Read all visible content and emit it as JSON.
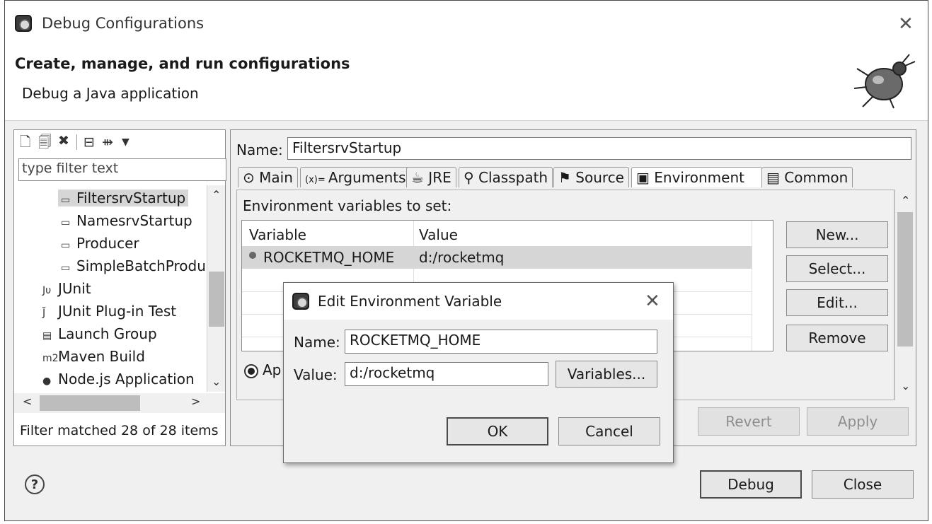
{
  "window": {
    "title": "Debug Configurations",
    "header_title": "Create, manage, and run configurations",
    "header_subtitle": "Debug a Java application",
    "icons": {
      "app": "eclipse-debug-icon",
      "bug": "bug-icon",
      "close": "close-icon"
    }
  },
  "left_panel": {
    "toolbar": [
      "new-config-icon",
      "duplicate-icon",
      "delete-icon",
      "collapse-all-icon",
      "filter-icon",
      "dropdown-arrow-icon"
    ],
    "filter_placeholder": "type filter text",
    "tree": [
      {
        "label": "FiltersrvStartup",
        "icon": "java-app-icon",
        "level": 2,
        "selected": true
      },
      {
        "label": "NamesrvStartup",
        "icon": "java-app-icon",
        "level": 2
      },
      {
        "label": "Producer",
        "icon": "java-app-icon",
        "level": 2
      },
      {
        "label": "SimpleBatchProdu",
        "icon": "java-app-icon",
        "level": 2
      },
      {
        "label": "JUnit",
        "icon": "junit-icon",
        "level": 1
      },
      {
        "label": "JUnit Plug-in Test",
        "icon": "junit-plugin-icon",
        "level": 1
      },
      {
        "label": "Launch Group",
        "icon": "launch-group-icon",
        "level": 1
      },
      {
        "label": "Maven Build",
        "icon": "maven-icon",
        "level": 1
      },
      {
        "label": "Node.js Application",
        "icon": "nodejs-icon",
        "level": 1
      }
    ],
    "status": "Filter matched 28 of 28 items"
  },
  "config": {
    "name_label": "Name:",
    "name_value": "FiltersrvStartup",
    "tabs": [
      {
        "label": "Main",
        "icon": "main-tab-icon"
      },
      {
        "label": "Arguments",
        "icon": "arguments-icon"
      },
      {
        "label": "JRE",
        "icon": "jre-icon"
      },
      {
        "label": "Classpath",
        "icon": "classpath-icon"
      },
      {
        "label": "Source",
        "icon": "source-icon"
      },
      {
        "label": "Environment",
        "icon": "environment-icon",
        "active": true
      },
      {
        "label": "Common",
        "icon": "common-icon"
      }
    ],
    "env_label": "Environment variables to set:",
    "table": {
      "columns": [
        "Variable",
        "Value"
      ],
      "rows": [
        {
          "variable": "ROCKETMQ_HOME",
          "value": "d:/rocketmq"
        }
      ]
    },
    "side_buttons": [
      "New...",
      "Select...",
      "Edit...",
      "Remove"
    ],
    "radio_label_partial": "Ap",
    "revert": "Revert",
    "apply": "Apply"
  },
  "dialog": {
    "title": "Edit Environment Variable",
    "name_label": "Name:",
    "name_value": "ROCKETMQ_HOME",
    "value_label": "Value:",
    "value_value": "d:/rocketmq",
    "variables_button": "Variables...",
    "ok": "OK",
    "cancel": "Cancel"
  },
  "footer": {
    "help": "?",
    "debug": "Debug",
    "close": "Close"
  }
}
